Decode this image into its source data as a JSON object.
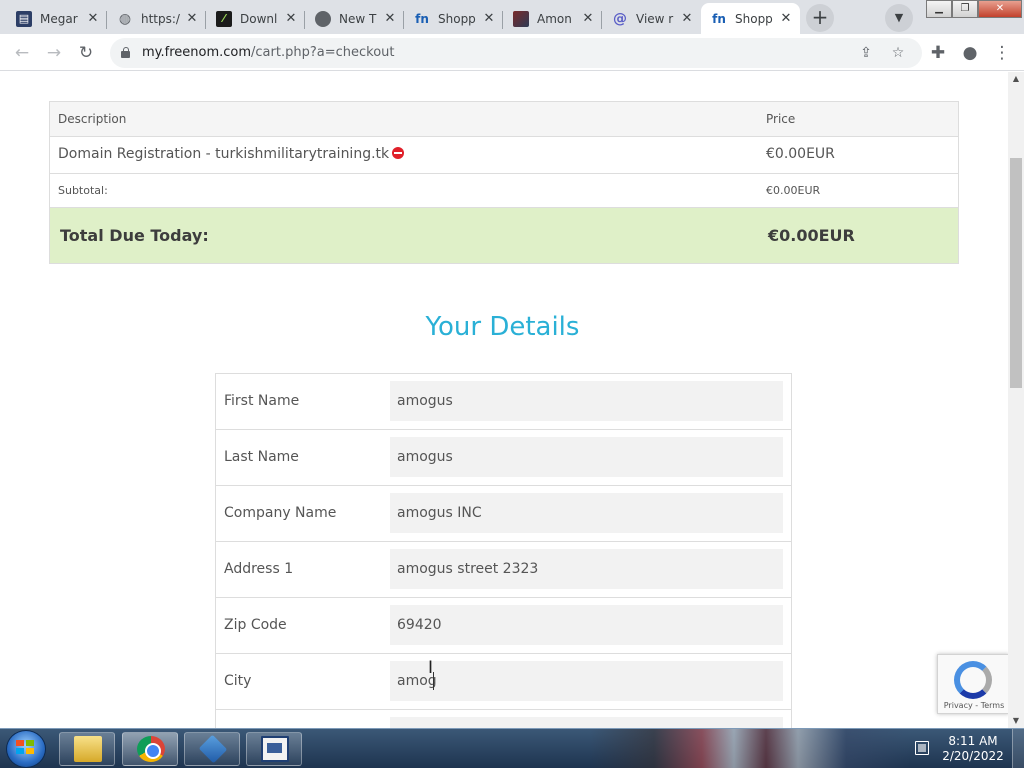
{
  "browser": {
    "tabs": [
      {
        "title": "Megar",
        "icon": "document-favicon-icon",
        "active": false
      },
      {
        "title": "https:/",
        "icon": "globe-icon",
        "active": false
      },
      {
        "title": "Downl",
        "icon": "download-favicon-icon",
        "active": false
      },
      {
        "title": "New T",
        "icon": "chrome-favicon-icon",
        "active": false
      },
      {
        "title": "Shopp",
        "icon": "freenom-favicon-icon",
        "active": false
      },
      {
        "title": "Amon",
        "icon": "image-favicon-icon",
        "active": false
      },
      {
        "title": "View r",
        "icon": "at-sign-icon",
        "active": false
      },
      {
        "title": "Shopp",
        "icon": "freenom-favicon-icon",
        "active": true
      }
    ],
    "url_host": "my.freenom.com",
    "url_path": "/cart.php?a=checkout"
  },
  "cart": {
    "header": {
      "description": "Description",
      "price": "Price"
    },
    "item": {
      "description": "Domain Registration - turkishmilitarytraining.tk",
      "price": "€0.00EUR"
    },
    "subtotal": {
      "label": "Subtotal:",
      "value": "€0.00EUR"
    },
    "total": {
      "label": "Total Due Today:",
      "value": "€0.00EUR"
    }
  },
  "details": {
    "title": "Your Details",
    "fields": [
      {
        "label": "First Name",
        "value": "amogus"
      },
      {
        "label": "Last Name",
        "value": "amogus"
      },
      {
        "label": "Company Name",
        "value": "amogus INC"
      },
      {
        "label": "Address 1",
        "value": "amogus street 2323"
      },
      {
        "label": "Zip Code",
        "value": "69420"
      },
      {
        "label": "City",
        "value": "amog"
      }
    ]
  },
  "recaptcha": {
    "links": "Privacy - Terms"
  },
  "taskbar": {
    "time": "8:11 AM",
    "date": "2/20/2022"
  },
  "colors": {
    "accent": "#2ab0d6",
    "total_bg": "#dff0c8",
    "remove": "#e0202a"
  }
}
